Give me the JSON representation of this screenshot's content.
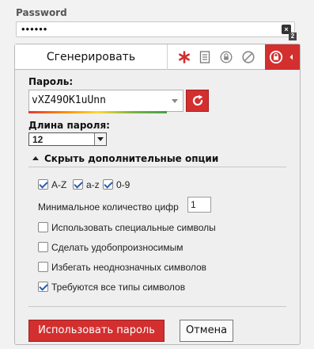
{
  "page": {
    "password_label": "Password",
    "password_value": "••••••",
    "lp_icon_glyph": "×",
    "lp_badge": "2"
  },
  "popup": {
    "tab_generate": "Сгенерировать",
    "tab_icons": [
      "asterisk-icon",
      "note-icon",
      "lock-icon",
      "block-icon",
      "lastpass-icon"
    ]
  },
  "generator": {
    "password_label": "Пароль:",
    "generated_password": "vXZ49OK1uUnn",
    "length_label": "Длина пароля:",
    "length_value": "12",
    "toggle_options": "Скрыть дополнительные опции",
    "opt_upper": "A-Z",
    "opt_lower": "a-z",
    "opt_digits": "0-9",
    "min_digits_label": "Минимальное количество цифр",
    "min_digits_value": "1",
    "opt_special": "Использовать специальные символы",
    "opt_pronounceable": "Сделать удобопроизносимым",
    "opt_avoid_ambiguous": "Избегать неоднозначных символов",
    "opt_require_all": "Требуются все типы символов",
    "use_button": "Использовать пароль",
    "cancel_button": "Отмена"
  },
  "colors": {
    "accent": "#d32f2f",
    "check": "#2a5db0"
  }
}
